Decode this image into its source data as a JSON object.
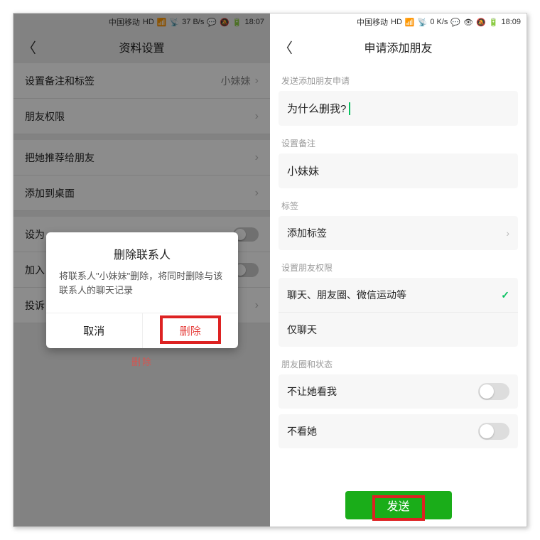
{
  "left": {
    "status": {
      "carrier": "中国移动",
      "net": "HD",
      "speed": "37 B/s",
      "time": "18:07"
    },
    "title": "资料设置",
    "rows": {
      "remark": {
        "label": "设置备注和标签",
        "value": "小妹妹"
      },
      "perm": {
        "label": "朋友权限"
      },
      "recommend": {
        "label": "把她推荐给朋友"
      },
      "desktop": {
        "label": "添加到桌面"
      },
      "set": {
        "label": "设为"
      },
      "add": {
        "label": "加入"
      },
      "report": {
        "label": "投诉"
      }
    },
    "dialog": {
      "title": "删除联系人",
      "body": "将联系人\"小妹妹\"删除，将同时删除与该联系人的聊天记录",
      "cancel": "取消",
      "delete": "删除"
    },
    "behind_delete": "删除"
  },
  "right": {
    "status": {
      "carrier": "中国移动",
      "net": "HD",
      "speed": "0 K/s",
      "time": "18:09"
    },
    "title": "申请添加朋友",
    "sections": {
      "request_label": "发送添加朋友申请",
      "request_value": "为什么删我?",
      "remark_label": "设置备注",
      "remark_value": "小妹妹",
      "tag_label": "标签",
      "tag_value": "添加标签",
      "perm_label": "设置朋友权限",
      "perm_opt1": "聊天、朋友圈、微信运动等",
      "perm_opt2": "仅聊天",
      "moments_label": "朋友圈和状态",
      "hide_from": "不让她看我",
      "hide_her": "不看她"
    },
    "send": "发送"
  }
}
